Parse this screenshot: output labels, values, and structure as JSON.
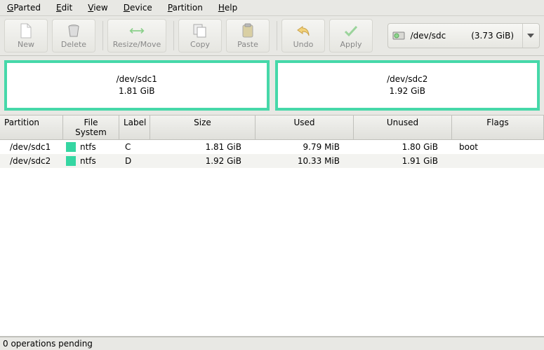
{
  "menu": {
    "gparted": "GParted",
    "edit": "Edit",
    "view": "View",
    "device": "Device",
    "partition": "Partition",
    "help": "Help"
  },
  "toolbar": {
    "new": "New",
    "delete": "Delete",
    "resize": "Resize/Move",
    "copy": "Copy",
    "paste": "Paste",
    "undo": "Undo",
    "apply": "Apply"
  },
  "device_selector": {
    "device": "/dev/sdc",
    "size": "(3.73 GiB)"
  },
  "viz": {
    "p1": {
      "name": "/dev/sdc1",
      "size": "1.81 GiB"
    },
    "p2": {
      "name": "/dev/sdc2",
      "size": "1.92 GiB"
    }
  },
  "columns": {
    "partition": "Partition",
    "fs": "File System",
    "label": "Label",
    "size": "Size",
    "used": "Used",
    "unused": "Unused",
    "flags": "Flags"
  },
  "rows": [
    {
      "partition": "/dev/sdc1",
      "fs": "ntfs",
      "label": "C",
      "size": "1.81 GiB",
      "used": "9.79 MiB",
      "unused": "1.80 GiB",
      "flags": "boot"
    },
    {
      "partition": "/dev/sdc2",
      "fs": "ntfs",
      "label": "D",
      "size": "1.92 GiB",
      "used": "10.33 MiB",
      "unused": "1.91 GiB",
      "flags": ""
    }
  ],
  "status": "0 operations pending"
}
